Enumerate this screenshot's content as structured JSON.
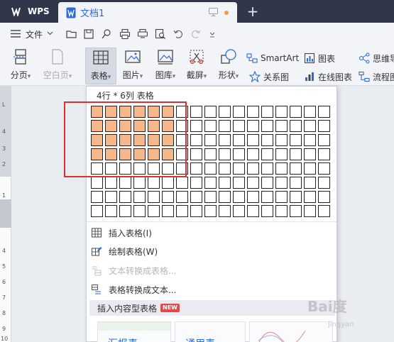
{
  "titlebar": {
    "app_name": "WPS",
    "doc_tab": "文档1",
    "new_tab_symbol": "+",
    "unsaved_dot_color": "#f39c3c"
  },
  "menubar": {
    "file_label": "文件",
    "quick_access_icons": [
      "open-folder-icon",
      "save-icon",
      "format-painter-icon",
      "print-icon",
      "print-preview-icon",
      "find-icon",
      "undo-icon",
      "redo-icon",
      "customize-caret-icon"
    ]
  },
  "ribbon": {
    "buttons": [
      {
        "label": "分页",
        "caret": "▾",
        "enabled": true
      },
      {
        "label": "空白页",
        "caret": "▾",
        "enabled": false
      },
      {
        "label": "表格",
        "caret": "▾",
        "enabled": true,
        "active": true
      },
      {
        "label": "图片",
        "caret": "▾",
        "enabled": true
      },
      {
        "label": "图库",
        "caret": "▾",
        "enabled": true
      },
      {
        "label": "截屏",
        "caret": "▾",
        "enabled": true
      },
      {
        "label": "形状",
        "caret": "▾",
        "enabled": true
      }
    ],
    "small": {
      "smartart": "SmartArt",
      "chart": "图表",
      "mindmap": "思维导",
      "relation": "关系图",
      "online_chart": "在线图表",
      "flowchart": "流程图"
    }
  },
  "dropdown": {
    "header": "4行 * 6列 表格",
    "grid_rows": 8,
    "grid_cols": 17,
    "selected_rows": 4,
    "selected_cols": 6,
    "selected_color": "#f6b88a",
    "highlight_color": "#d9312c",
    "items": [
      {
        "label": "插入表格(I)",
        "enabled": true
      },
      {
        "label": "绘制表格(W)",
        "enabled": true
      },
      {
        "label": "文本转换成表格...",
        "enabled": false
      },
      {
        "label": "表格转换成文本...",
        "enabled": true
      }
    ],
    "section_title": "插入内容型表格",
    "section_badge": "NEW",
    "thumbnails": [
      "汇报表",
      "通用表"
    ]
  },
  "ruler": {
    "numbers": [
      "L",
      "4",
      "3",
      "2",
      "1",
      "4",
      "5",
      "6",
      "7",
      "8",
      "9",
      "10"
    ]
  },
  "watermark": {
    "text": "Bai度",
    "sub": "jingyan"
  }
}
